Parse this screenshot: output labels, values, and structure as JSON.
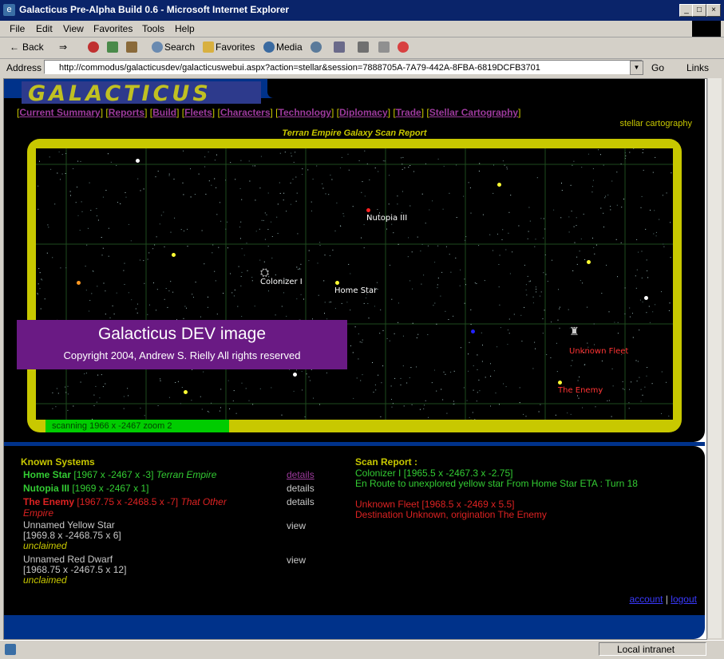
{
  "window": {
    "title": "Galacticus Pre-Alpha Build 0.6 - Microsoft Internet Explorer",
    "minimize": "_",
    "maximize": "□",
    "close": "×"
  },
  "menu": [
    "File",
    "Edit",
    "View",
    "Favorites",
    "Tools",
    "Help"
  ],
  "toolbar": {
    "back": "Back",
    "search": "Search",
    "favorites": "Favorites",
    "media": "Media"
  },
  "address": {
    "label": "Address",
    "url": "http://commodus/galacticusdev/galacticuswebui.aspx?action=stellar&session=7888705A-7A79-442A-8FBA-6819DCFB3701",
    "go": "Go",
    "links": "Links"
  },
  "page": {
    "logo": "GALACTICUS",
    "nav": [
      "Current Summary",
      "Reports",
      "Build",
      "Fleets",
      "Characters",
      "Technology",
      "Diplomacy",
      "Trade",
      "Stellar Cartography"
    ],
    "section_tag": "stellar cartography",
    "map_title": "Terran Empire Galaxy Scan Report",
    "map_status": "scanning 1966 x -2467  zoom 2",
    "watermark": {
      "line1": "Galacticus DEV image",
      "line2": "Copyright 2004, Andrew S. Rielly All rights reserved"
    },
    "map_labels": {
      "nutopia": "Nutopia III",
      "colonizer": "Colonizer I",
      "home": "Home Star",
      "unknown_fleet": "Unknown Fleet",
      "enemy": "The Enemy"
    }
  },
  "known_systems": {
    "heading": "Known Systems",
    "items": [
      {
        "name": "Home Star",
        "coords": "[1967 x -2467 x -3]",
        "owner": "Terran Empire",
        "action": "details"
      },
      {
        "name": "Nutopia III",
        "coords": "[1969 x -2467 x 1]",
        "owner": "",
        "action": "details"
      },
      {
        "name": "The Enemy",
        "coords": "[1967.75 x -2468.5 x -7]",
        "owner": "That Other Empire",
        "action": "details"
      },
      {
        "name": "Unnamed Yellow Star",
        "coords": "[1969.8 x -2468.75 x 6]",
        "owner": "unclaimed",
        "action": "view"
      },
      {
        "name": "Unnamed Red Dwarf",
        "coords": "[1968.75 x -2467.5 x 12]",
        "owner": "unclaimed",
        "action": "view"
      }
    ]
  },
  "scan_report": {
    "heading": "Scan Report :",
    "lines": [
      "Colonizer I [1965.5 x -2467.3 x -2.75]",
      "En Route to unexplored yellow star From Home Star ETA : Turn 18",
      "Unknown Fleet [1968.5 x -2469 x 5.5]",
      "Destination Unknown, origination The Enemy"
    ]
  },
  "footer": {
    "account": "account",
    "separator": "|",
    "logout": "logout"
  },
  "status": {
    "zone": "Local intranet"
  },
  "colors": {
    "accent_yellow": "#c8c800",
    "friendly": "#33cc33",
    "hostile": "#dd2222",
    "nav_link": "#9c3a9c"
  }
}
